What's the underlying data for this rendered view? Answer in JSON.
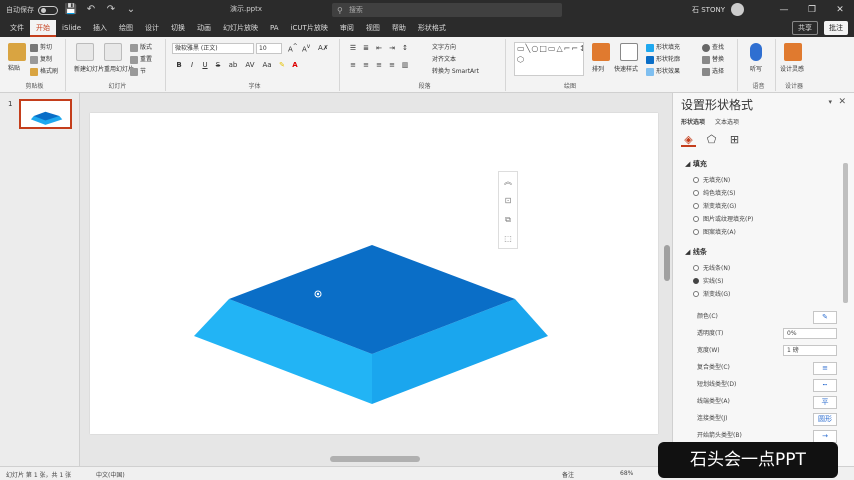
{
  "titlebar": {
    "autosave_label": "自动保存",
    "autosave_state": "关",
    "doc_title": "演示.pptx",
    "search_placeholder": "搜索",
    "user_name": "石 STONY",
    "minimize": "—",
    "restore": "❐",
    "close": "✕"
  },
  "tabs": [
    {
      "label": "文件"
    },
    {
      "label": "开始",
      "active": true
    },
    {
      "label": "iSlide"
    },
    {
      "label": "插入"
    },
    {
      "label": "绘图"
    },
    {
      "label": "设计"
    },
    {
      "label": "切换"
    },
    {
      "label": "动画"
    },
    {
      "label": "幻灯片放映"
    },
    {
      "label": "PA"
    },
    {
      "label": "iCUT片放映"
    },
    {
      "label": "审阅"
    },
    {
      "label": "视图"
    },
    {
      "label": "帮助"
    },
    {
      "label": "形状格式"
    }
  ],
  "tab_actions": {
    "share": "共享",
    "comment": "批注"
  },
  "ribbon": {
    "clipboard": {
      "paste": "粘贴",
      "cut": "剪切",
      "copy": "复制",
      "format_painter": "格式刷",
      "label": "剪贴板"
    },
    "slides": {
      "new_slide": "新建幻灯片",
      "reuse": "重用幻灯片",
      "layout": "版式",
      "reset": "重置",
      "section": "节",
      "label": "幻灯片"
    },
    "font": {
      "font_name": "微软雅黑 (正文)",
      "font_size": "10",
      "label": "字体",
      "bold": "B",
      "italic": "I",
      "underline": "U",
      "strike": "S",
      "shadow": "ab",
      "spacing": "AV",
      "case": "Aa"
    },
    "paragraph": {
      "text_direction": "文字方向",
      "align_text": "对齐文本",
      "smartart": "转换为 SmartArt",
      "label": "段落"
    },
    "drawing": {
      "arrange": "排列",
      "quick_styles": "快速样式",
      "fill": "形状填充",
      "outline": "形状轮廓",
      "effects": "形状效果",
      "label": "绘图",
      "shapes": "▭╲○□▭△⌐⌐↕↔⇒☆{}⬡"
    },
    "editing": {
      "find": "查找",
      "replace": "替换",
      "select": "选择",
      "label": "编辑"
    },
    "voice": {
      "dictate": "听写",
      "label": "语音"
    },
    "designer": {
      "ideas": "设计灵感",
      "label": "设计器"
    }
  },
  "thumbnails": [
    {
      "number": "1"
    }
  ],
  "format_pane": {
    "title": "设置形状格式",
    "tabs": [
      "形状选项",
      "文本选项"
    ],
    "fill_section": "填充",
    "fill_options": [
      {
        "label": "无填充(N)",
        "checked": false
      },
      {
        "label": "纯色填充(S)",
        "checked": false
      },
      {
        "label": "渐变填充(G)",
        "checked": false
      },
      {
        "label": "图片或纹理填充(P)",
        "checked": false
      },
      {
        "label": "图案填充(A)",
        "checked": false
      }
    ],
    "line_section": "线条",
    "line_options": [
      {
        "label": "无线条(N)",
        "checked": false
      },
      {
        "label": "实线(S)",
        "checked": true
      },
      {
        "label": "渐变线(G)",
        "checked": false
      }
    ],
    "props": [
      {
        "label": "颜色(C)",
        "value": "✎"
      },
      {
        "label": "透明度(T)",
        "value": "0%"
      },
      {
        "label": "宽度(W)",
        "value": "1 磅"
      },
      {
        "label": "复合类型(C)",
        "value": "≡"
      },
      {
        "label": "短划线类型(D)",
        "value": "┅"
      },
      {
        "label": "线端类型(A)",
        "value": "平"
      },
      {
        "label": "连接类型(J)",
        "value": "圆形"
      },
      {
        "label": "开始箭头类型(B)",
        "value": "→"
      }
    ]
  },
  "statusbar": {
    "slide_info": "幻灯片 第 1 张，共 1 张",
    "language": "中文(中国)",
    "notes": "备注",
    "zoom": "68%"
  },
  "watermark": "石头会一点PPT",
  "colors": {
    "accent": "#c43e1c",
    "top_face": "#0a6ec7",
    "side_face": "#1ea8ef",
    "side_face_dark": "#2db6f6"
  }
}
